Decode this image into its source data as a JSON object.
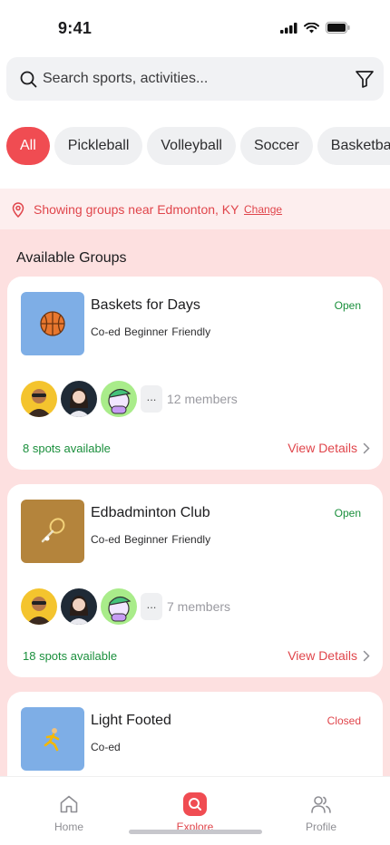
{
  "status_bar": {
    "time": "9:41",
    "icons": [
      "signal-icon",
      "wifi-icon",
      "battery-icon"
    ]
  },
  "search": {
    "placeholder": "Search sports, activities...",
    "value": ""
  },
  "filters": {
    "chips": [
      "All",
      "Pickleball",
      "Volleyball",
      "Soccer",
      "Basketball"
    ],
    "selected": "All"
  },
  "location": {
    "text": "Showing groups near Edmonton, KY",
    "change_label": "Change"
  },
  "section_title": "Available Groups",
  "groups": [
    {
      "name": "Baskets for Days",
      "tags": "Co-ed  Beginner Friendly",
      "status": "Open",
      "thumb_icon": "basketball-icon",
      "thumb_color": "#7eaee6",
      "more": "...",
      "members": "12 members",
      "spots": "8 spots available",
      "cta": "View Details"
    },
    {
      "name": "Edbadminton Club",
      "tags": "Co-ed  Beginner Friendly",
      "status": "Open",
      "thumb_icon": "badminton-icon",
      "thumb_color": "#b4843c",
      "more": "...",
      "members": "7 members",
      "spots": "18 spots available",
      "cta": "View Details"
    },
    {
      "name": "Light Footed",
      "tags": "Co-ed",
      "status": "Closed",
      "thumb_icon": "runner-icon",
      "thumb_color": "#7eaee6"
    }
  ],
  "tabs": [
    {
      "label": "Home",
      "icon": "home-icon",
      "active": false
    },
    {
      "label": "Explore",
      "icon": "explore-icon",
      "active": true
    },
    {
      "label": "Profile",
      "icon": "profile-icon",
      "active": false
    }
  ],
  "colors": {
    "accent": "#f04c52",
    "open": "#1a8f3c",
    "banner_bg": "#fdeeee",
    "list_bg": "#fde0e0"
  }
}
